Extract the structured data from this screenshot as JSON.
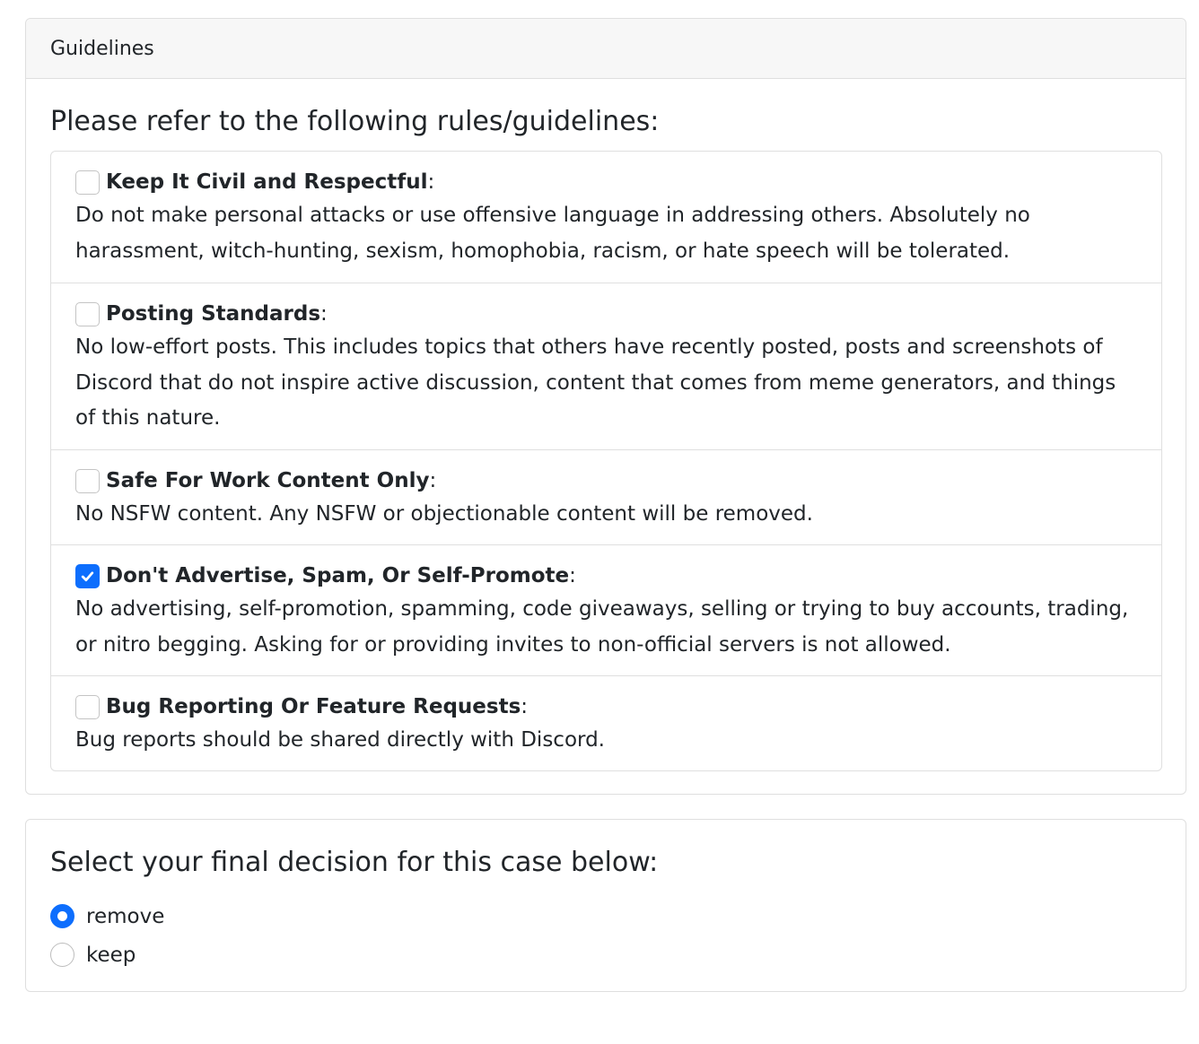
{
  "guidelines_card": {
    "header": "Guidelines",
    "title": "Please refer to the following rules/guidelines:",
    "rules": [
      {
        "title": "Keep It Civil and Respectful",
        "suffix": ":",
        "checked": false,
        "description": "Do not make personal attacks or use offensive language in addressing others. Absolutely no harassment, witch-hunting, sexism, homophobia, racism, or hate speech will be tolerated."
      },
      {
        "title": "Posting Standards",
        "suffix": ":",
        "checked": false,
        "description": "No low-effort posts. This includes topics that others have recently posted, posts and screenshots of Discord that do not inspire active discussion, content that comes from meme generators, and things of this nature."
      },
      {
        "title": "Safe For Work Content Only",
        "suffix": ":",
        "checked": false,
        "description": "No NSFW content. Any NSFW or objectionable content will be removed."
      },
      {
        "title": "Don't Advertise, Spam, Or Self-Promote",
        "suffix": ":",
        "checked": true,
        "description": "No advertising, self-promotion, spamming, code giveaways, selling or trying to buy accounts, trading, or nitro begging. Asking for or providing invites to non-official servers is not allowed."
      },
      {
        "title": "Bug Reporting Or Feature Requests",
        "suffix": " :",
        "checked": false,
        "description": "Bug reports should be shared directly with Discord."
      }
    ]
  },
  "decision_card": {
    "title": "Select your final decision for this case below:",
    "options": [
      {
        "label": "remove",
        "selected": true
      },
      {
        "label": "keep",
        "selected": false
      }
    ]
  },
  "colors": {
    "accent": "#0d6efd",
    "border": "#dfdfdf",
    "header_bg": "#f7f7f7",
    "text": "#212529"
  }
}
